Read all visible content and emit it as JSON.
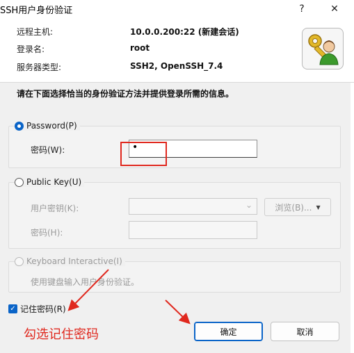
{
  "window": {
    "title": "SSH用户身份验证",
    "help_button": "?",
    "close_button": "✕"
  },
  "info": {
    "host_label": "远程主机:",
    "host_value": "10.0.0.200:22 (新建会话)",
    "login_label": "登录名:",
    "login_value": "root",
    "server_label": "服务器类型:",
    "server_value": "SSH2, OpenSSH_7.4"
  },
  "instruction": "请在下面选择恰当的身份验证方法并提供登录所需的信息。",
  "password_method": {
    "label": "Password(P)",
    "selected": true,
    "password_label": "密码(W):",
    "password_value": "•"
  },
  "pubkey_method": {
    "label": "Public Key(U)",
    "selected": false,
    "user_key_label": "用户密钥(K):",
    "browse_label": "浏览(B)...",
    "passphrase_label": "密码(H):"
  },
  "keyboard_method": {
    "label": "Keyboard Interactive(I)",
    "description": "使用键盘输入用户身份验证。"
  },
  "remember": {
    "label": "记住密码(R)",
    "checked": true
  },
  "buttons": {
    "ok": "确定",
    "cancel": "取消"
  },
  "annotation": {
    "note": "勾选记住密码",
    "color": "#e0281e"
  },
  "colors": {
    "accent": "#0a64c8",
    "panel": "#f0f0f0",
    "annotation_red": "#e0281e"
  }
}
